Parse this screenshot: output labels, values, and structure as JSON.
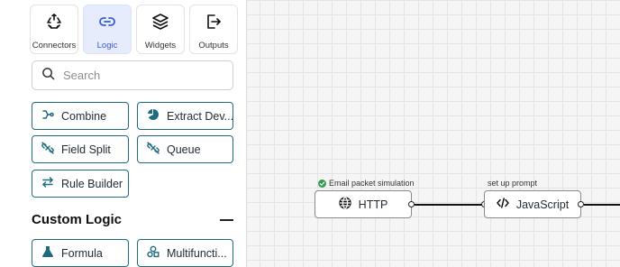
{
  "panel": {
    "tabs": [
      {
        "label": "Connectors",
        "icon": "connectors-icon"
      },
      {
        "label": "Logic",
        "icon": "logic-link-icon"
      },
      {
        "label": "Widgets",
        "icon": "layers-icon"
      },
      {
        "label": "Outputs",
        "icon": "exit-arrow-icon"
      }
    ],
    "active_tab": "Logic",
    "search": {
      "placeholder": "Search",
      "value": ""
    },
    "logic_items": [
      {
        "label": "Combine",
        "icon": "merge-icon"
      },
      {
        "label": "Extract Dev...",
        "icon": "pie-chart-icon"
      },
      {
        "label": "Field Split",
        "icon": "broken-link-icon"
      },
      {
        "label": "Queue",
        "icon": "broken-link-icon"
      },
      {
        "label": "Rule Builder",
        "icon": "swap-arrows-icon"
      }
    ],
    "custom_logic": {
      "title": "Custom Logic",
      "items": [
        {
          "label": "Formula",
          "icon": "flask-icon"
        },
        {
          "label": "Multifuncti...",
          "icon": "shapes-icon"
        }
      ]
    }
  },
  "canvas": {
    "nodes": [
      {
        "label": "HTTP",
        "caption": "Email packet simulation",
        "caption_icon": "check-circle-icon",
        "icon": "globe-icon"
      },
      {
        "label": "JavaScript",
        "caption": "set up prompt",
        "icon": "code-icon"
      }
    ]
  },
  "colors": {
    "accent": "#3c5bd8",
    "active_tab_bg": "#e6ecfb",
    "chip_border": "#1e6b80",
    "status_ok": "#2e9e4f"
  }
}
